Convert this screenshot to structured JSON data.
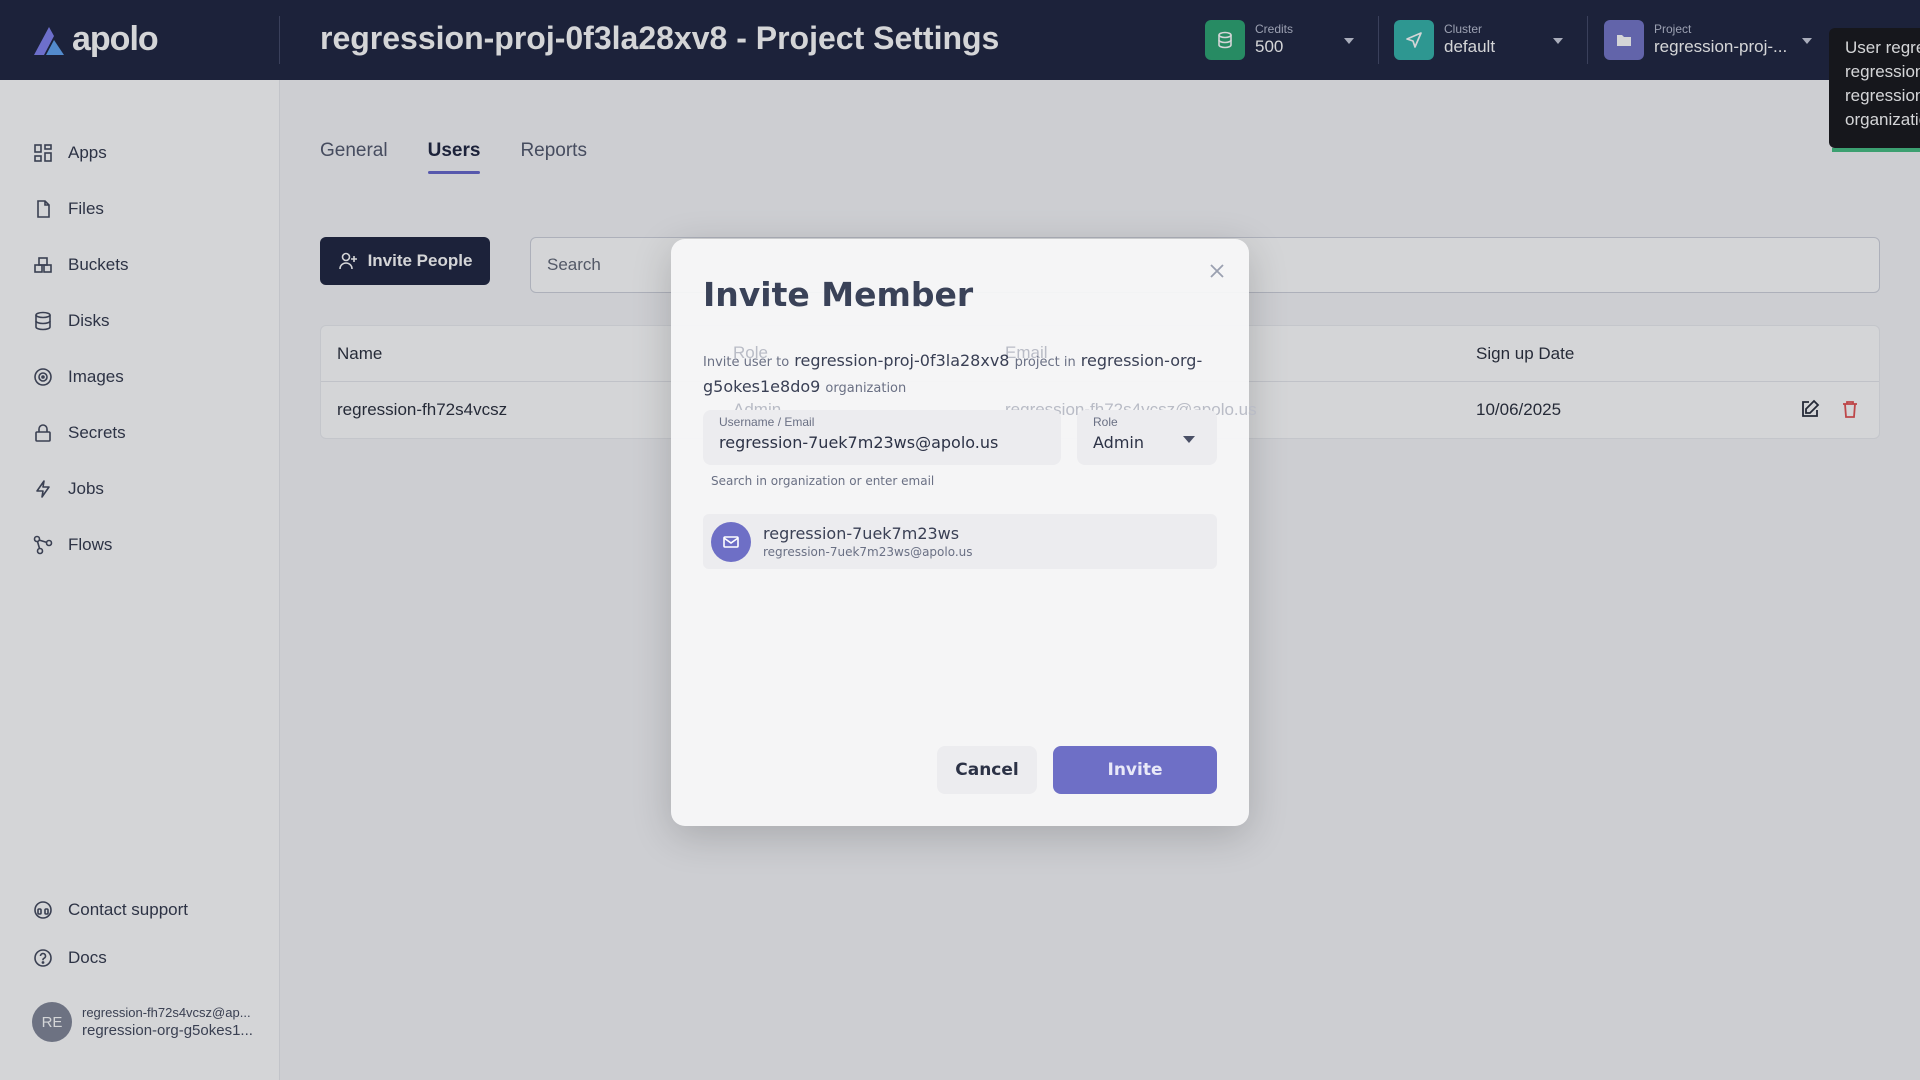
{
  "header": {
    "logo_text": "apolo",
    "title": "regression-proj-0f3la28xv8 - Project Settings",
    "credits": {
      "label": "Credits",
      "value": "500",
      "icon": "coins-icon",
      "color": "#22a06b"
    },
    "cluster": {
      "label": "Cluster",
      "value": "default",
      "icon": "send-icon",
      "color": "#2bb0a6"
    },
    "project": {
      "label": "Project",
      "value": "regression-proj-...",
      "icon": "folder-icon",
      "color": "#6e6fc6"
    }
  },
  "tooltip": {
    "lines": [
      "User regre",
      "regression",
      "regression",
      "organizatio"
    ]
  },
  "sidebar": {
    "items": [
      {
        "label": "Apps",
        "icon": "grid-icon"
      },
      {
        "label": "Files",
        "icon": "file-icon"
      },
      {
        "label": "Buckets",
        "icon": "buckets-icon"
      },
      {
        "label": "Disks",
        "icon": "database-icon"
      },
      {
        "label": "Images",
        "icon": "image-icon"
      },
      {
        "label": "Secrets",
        "icon": "lock-icon"
      },
      {
        "label": "Jobs",
        "icon": "bolt-icon"
      },
      {
        "label": "Flows",
        "icon": "flows-icon"
      }
    ],
    "footer": [
      {
        "label": "Contact support",
        "icon": "headset-icon"
      },
      {
        "label": "Docs",
        "icon": "help-icon"
      }
    ],
    "user": {
      "initials": "RE",
      "email": "regression-fh72s4vcsz@ap...",
      "org": "regression-org-g5okes1..."
    }
  },
  "tabs": [
    {
      "label": "General",
      "active": false
    },
    {
      "label": "Users",
      "active": true
    },
    {
      "label": "Reports",
      "active": false
    }
  ],
  "toolbar": {
    "invite_label": "Invite People",
    "search_placeholder": "Search"
  },
  "table": {
    "headers": {
      "name": "Name",
      "role": "Role",
      "email": "Email",
      "signup": "Sign up Date"
    },
    "rows": [
      {
        "name": "regression-fh72s4vcsz",
        "role": "Admin",
        "email": "regression-fh72s4vcsz@apolo.us",
        "signup": "10/06/2025"
      }
    ]
  },
  "modal": {
    "title": "Invite Member",
    "desc_prefix": "Invite user to",
    "project": "regression-proj-0f3la28xv8",
    "desc_mid": "project in",
    "org_part1": "regression-org-",
    "org_part2": "g5okes1e8do9",
    "desc_suffix": "organization",
    "username_label": "Username / Email",
    "username_value": "regression-7uek7m23ws@apolo.us",
    "role_label": "Role",
    "role_value": "Admin",
    "helper": "Search in organization or enter email",
    "suggestion": {
      "name": "regression-7uek7m23ws",
      "email": "regression-7uek7m23ws@apolo.us"
    },
    "cancel_label": "Cancel",
    "invite_label": "Invite"
  }
}
